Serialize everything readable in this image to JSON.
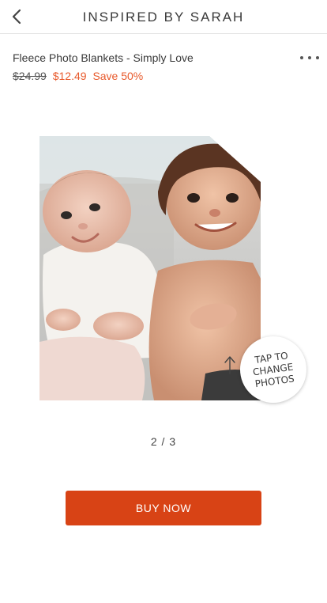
{
  "header": {
    "title": "INSPIRED BY SARAH",
    "back_icon": "chevron-left-icon"
  },
  "product": {
    "name": "Fleece Photo Blankets - Simply Love",
    "original_price": "$24.99",
    "sale_price": "$12.49",
    "save_text": "Save 50%",
    "more_icon": "more-horizontal-icon"
  },
  "preview": {
    "tap_label": "TAP TO\nCHANGE\nPHOTOS",
    "page_indicator": "2 / 3"
  },
  "actions": {
    "buy_label": "BUY NOW"
  },
  "colors": {
    "accent": "#d84315",
    "sale_text": "#e85a2c"
  }
}
